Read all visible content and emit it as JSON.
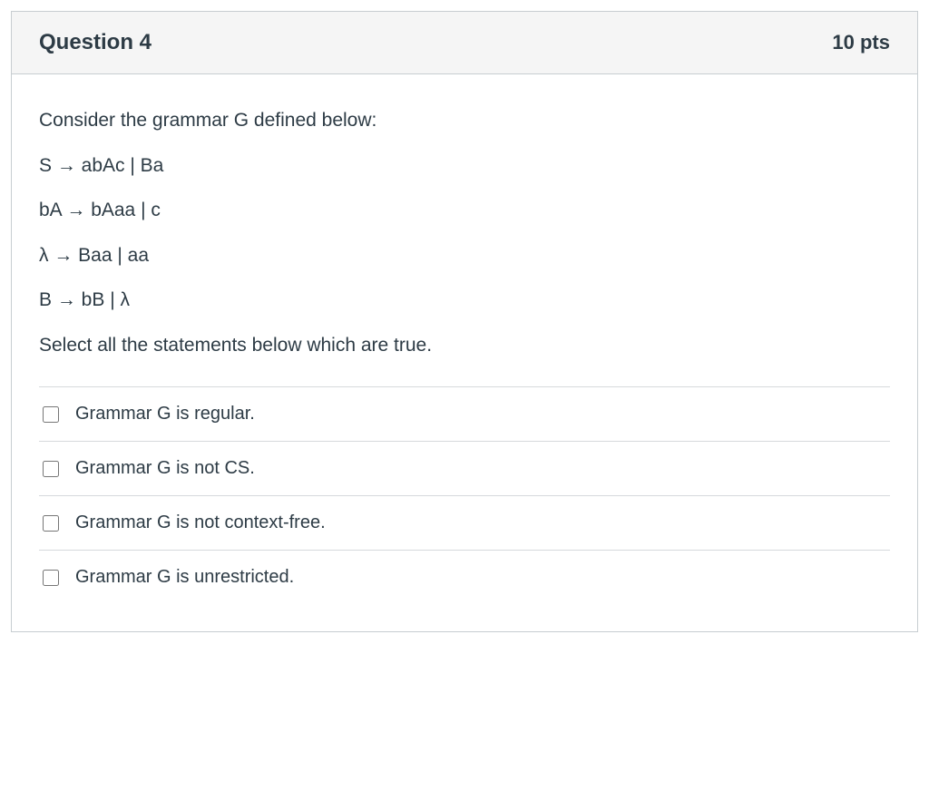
{
  "header": {
    "title": "Question 4",
    "points": "10 pts"
  },
  "prompt": {
    "intro": "Consider the grammar G defined below:",
    "rules": [
      "S → abAc | Ba",
      "bA → bAaa | c",
      "λ → Baa | aa",
      "B → bB | λ"
    ],
    "instruction": "Select all the statements below which are true."
  },
  "options": [
    {
      "label": "Grammar G is regular."
    },
    {
      "label": "Grammar G is not CS."
    },
    {
      "label": "Grammar G is not context-free."
    },
    {
      "label": "Grammar G is unrestricted."
    }
  ]
}
